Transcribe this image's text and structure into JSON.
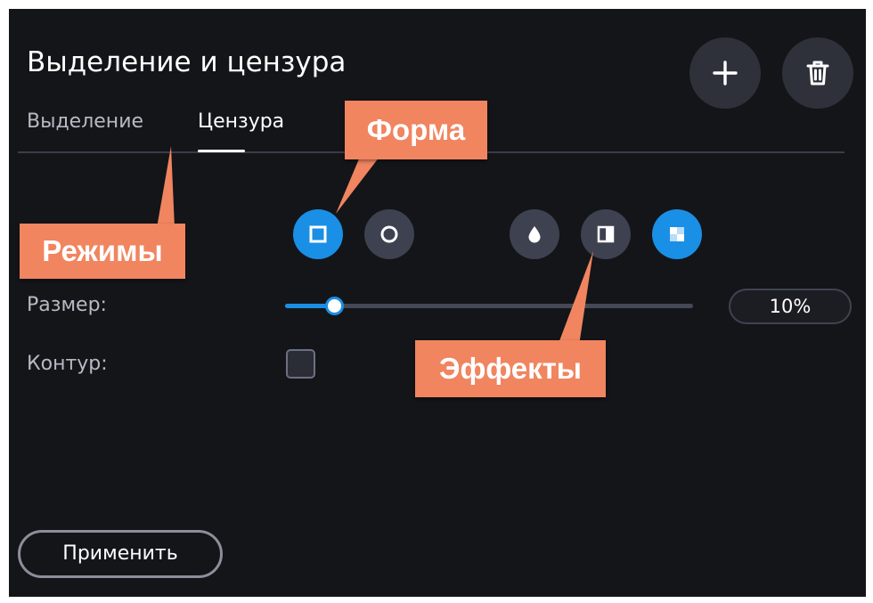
{
  "panel": {
    "title": "Выделение и цензура"
  },
  "header_buttons": {
    "add_icon": "plus-icon",
    "delete_icon": "trash-icon"
  },
  "tabs": [
    {
      "label": "Выделение",
      "active": false
    },
    {
      "label": "Цензура",
      "active": true
    }
  ],
  "shapes": [
    {
      "icon": "square-icon",
      "selected": true
    },
    {
      "icon": "circle-icon",
      "selected": false
    }
  ],
  "effects": [
    {
      "icon": "blur-drop-icon",
      "selected": false
    },
    {
      "icon": "solid-fill-icon",
      "selected": false
    },
    {
      "icon": "pixelate-icon",
      "selected": true
    }
  ],
  "size": {
    "label": "Размер:",
    "value_text": "10%",
    "slider_fraction": 0.12
  },
  "outline": {
    "label": "Контур:",
    "checked": false
  },
  "apply_button": {
    "label": "Применить"
  },
  "callouts": {
    "shape": "Форма",
    "modes": "Режимы",
    "effects": "Эффекты"
  },
  "colors": {
    "accent": "#1a8fe6",
    "callout": "#f08560",
    "panel_bg": "#141519"
  }
}
